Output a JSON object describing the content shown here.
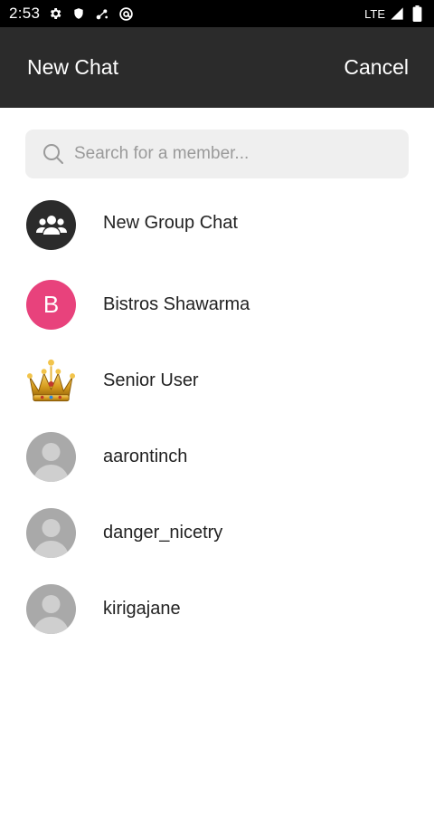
{
  "status_bar": {
    "time": "2:53",
    "network": "LTE",
    "icons": [
      "gear-icon",
      "shield-icon",
      "network-icon",
      "at-icon",
      "signal-icon",
      "battery-icon"
    ]
  },
  "header": {
    "title": "New Chat",
    "cancel_label": "Cancel",
    "background": "#2b2b2b"
  },
  "search": {
    "placeholder": "Search for a member..."
  },
  "list": {
    "items": [
      {
        "label": "New Group Chat",
        "avatar": "group-icon"
      },
      {
        "label": "Bistros Shawarma",
        "avatar_letter": "B",
        "avatar_color": "#e8427c"
      },
      {
        "label": "Senior User",
        "avatar": "crown-icon"
      },
      {
        "label": "aarontinch",
        "avatar": "default-user-icon"
      },
      {
        "label": "danger_nicetry",
        "avatar": "default-user-icon"
      },
      {
        "label": "kirigajane",
        "avatar": "default-user-icon"
      }
    ]
  }
}
